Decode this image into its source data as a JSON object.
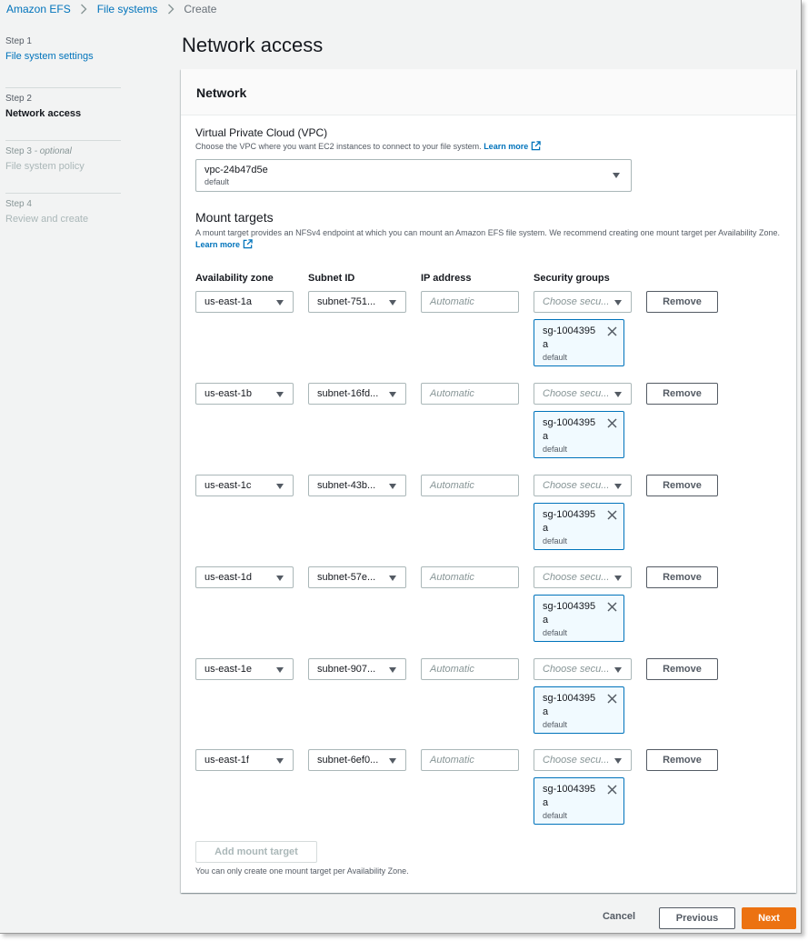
{
  "breadcrumb": [
    {
      "label": "Amazon EFS",
      "link": true
    },
    {
      "label": "File systems",
      "link": true
    },
    {
      "label": "Create",
      "link": false
    }
  ],
  "steps": [
    {
      "num": "Step 1",
      "optional": "",
      "title": "File system settings",
      "state": "done"
    },
    {
      "num": "Step 2",
      "optional": "",
      "title": "Network access",
      "state": "current"
    },
    {
      "num": "Step 3",
      "optional": " - optional",
      "title": "File system policy",
      "state": "future"
    },
    {
      "num": "Step 4",
      "optional": "",
      "title": "Review and create",
      "state": "future"
    }
  ],
  "page_title": "Network access",
  "network": {
    "header": "Network",
    "vpc_label": "Virtual Private Cloud (VPC)",
    "vpc_desc": "Choose the VPC where you want EC2 instances to connect to your file system.",
    "learn_more": "Learn more",
    "vpc_value": "vpc-24b47d5e",
    "vpc_sub": "default"
  },
  "mount_targets": {
    "title": "Mount targets",
    "desc": "A mount target provides an NFSv4 endpoint at which you can mount an Amazon EFS file system. We recommend creating one mount target per Availability Zone.",
    "learn_more": "Learn more",
    "columns": {
      "az": "Availability zone",
      "subnet": "Subnet ID",
      "ip": "IP address",
      "sg": "Security groups"
    },
    "ip_placeholder": "Automatic",
    "sg_placeholder": "Choose secu...",
    "remove_label": "Remove",
    "rows": [
      {
        "az": "us-east-1a",
        "subnet": "subnet-751...",
        "sg_id": "sg-1004395a",
        "sg_sub": "default"
      },
      {
        "az": "us-east-1b",
        "subnet": "subnet-16fd...",
        "sg_id": "sg-1004395a",
        "sg_sub": "default"
      },
      {
        "az": "us-east-1c",
        "subnet": "subnet-43b...",
        "sg_id": "sg-1004395a",
        "sg_sub": "default"
      },
      {
        "az": "us-east-1d",
        "subnet": "subnet-57e...",
        "sg_id": "sg-1004395a",
        "sg_sub": "default"
      },
      {
        "az": "us-east-1e",
        "subnet": "subnet-907...",
        "sg_id": "sg-1004395a",
        "sg_sub": "default"
      },
      {
        "az": "us-east-1f",
        "subnet": "subnet-6ef0...",
        "sg_id": "sg-1004395a",
        "sg_sub": "default"
      }
    ],
    "add_label": "Add mount target",
    "add_note": "You can only create one mount target per Availability Zone."
  },
  "footer": {
    "cancel": "Cancel",
    "previous": "Previous",
    "next": "Next"
  },
  "colors": {
    "link": "#0073bb",
    "primary_button": "#ec7211",
    "token_bg": "#f1faff"
  }
}
